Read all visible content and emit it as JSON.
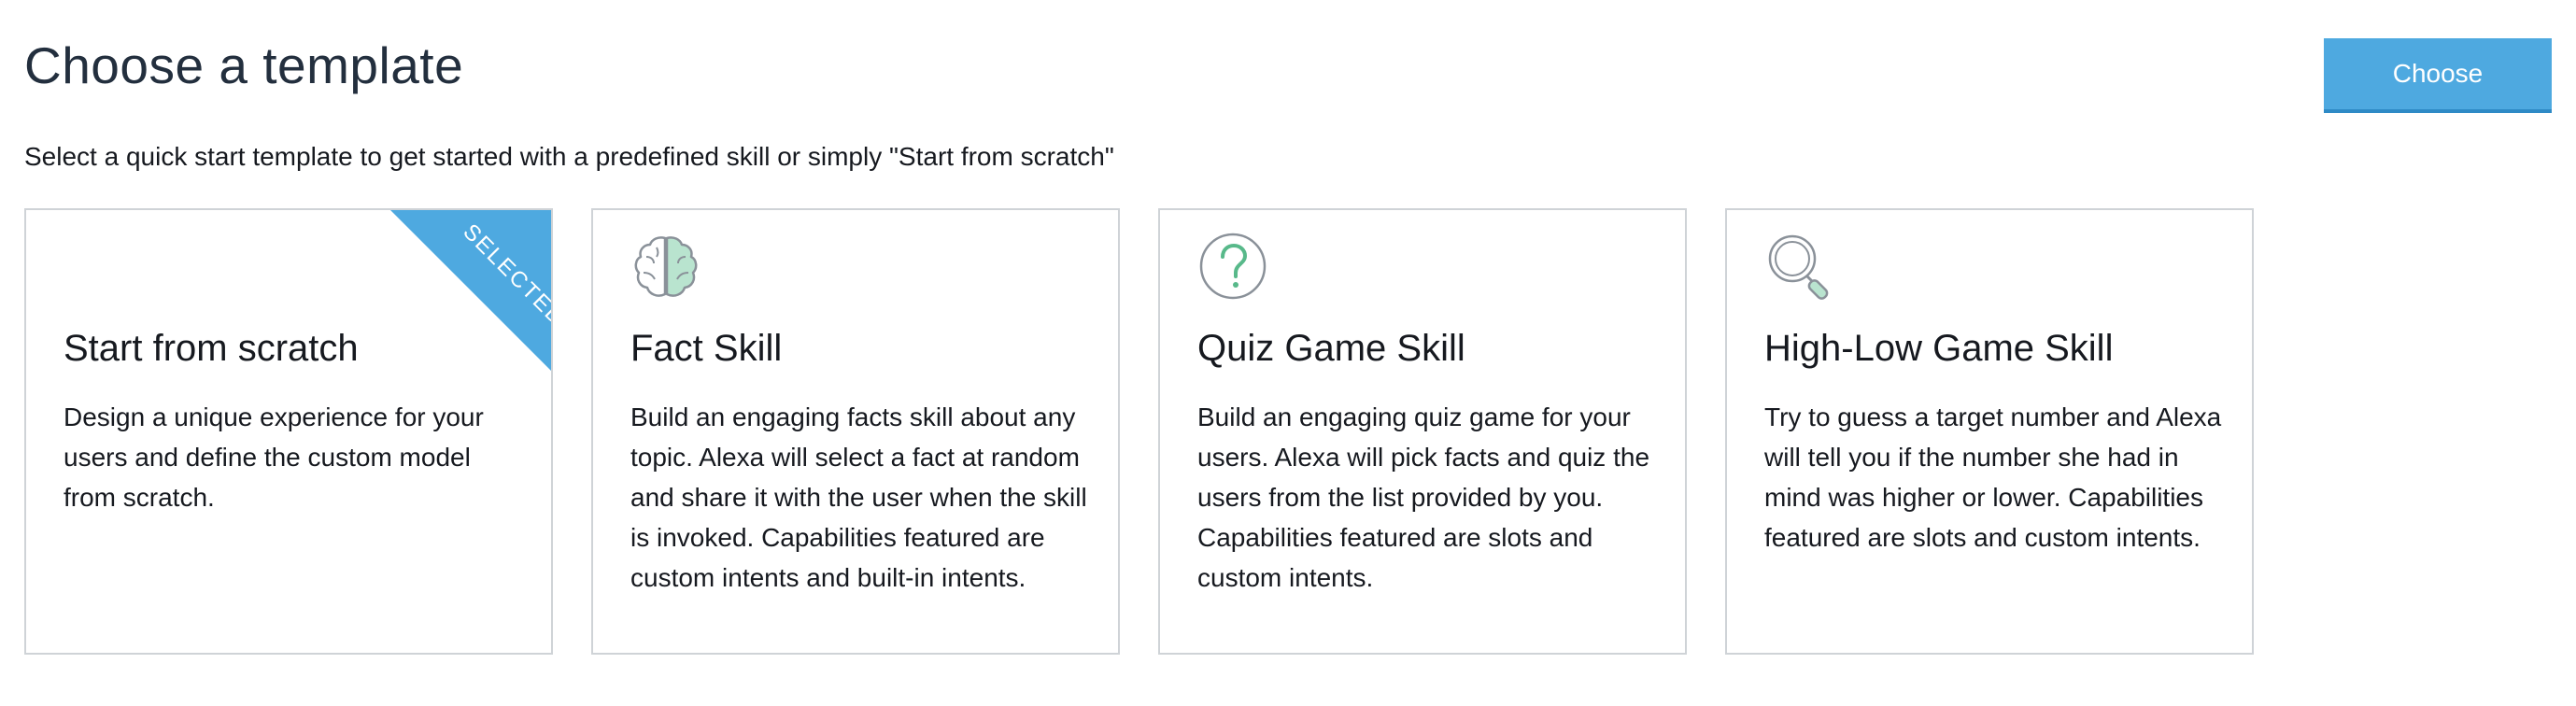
{
  "header": {
    "title": "Choose a template",
    "subtitle": "Select a quick start template to get started with a predefined skill or simply \"Start from scratch\"",
    "choose_label": "Choose"
  },
  "colors": {
    "accent": "#4ea9e0",
    "card_border": "#cfd3d7",
    "icon_stroke": "#8a9199",
    "icon_fill": "#b9e4cf"
  },
  "cards": [
    {
      "title": "Start from scratch",
      "description": "Design a unique experience for your users and define the custom model from scratch.",
      "selected": true,
      "badge": "SELECTED",
      "icon": "none"
    },
    {
      "title": "Fact Skill",
      "description": "Build an engaging facts skill about any topic. Alexa will select a fact at random and share it with the user when the skill is invoked. Capabilities featured are custom intents and built-in intents.",
      "selected": false,
      "icon": "brain-icon"
    },
    {
      "title": "Quiz Game Skill",
      "description": "Build an engaging quiz game for your users. Alexa will pick facts and quiz the users from the list provided by you. Capabilities featured are slots and custom intents.",
      "selected": false,
      "icon": "question-mark-icon"
    },
    {
      "title": "High-Low Game Skill",
      "description": "Try to guess a target number and Alexa will tell you if the number she had in mind was higher or lower. Capabilities featured are slots and custom intents.",
      "selected": false,
      "icon": "magnifier-icon"
    }
  ]
}
